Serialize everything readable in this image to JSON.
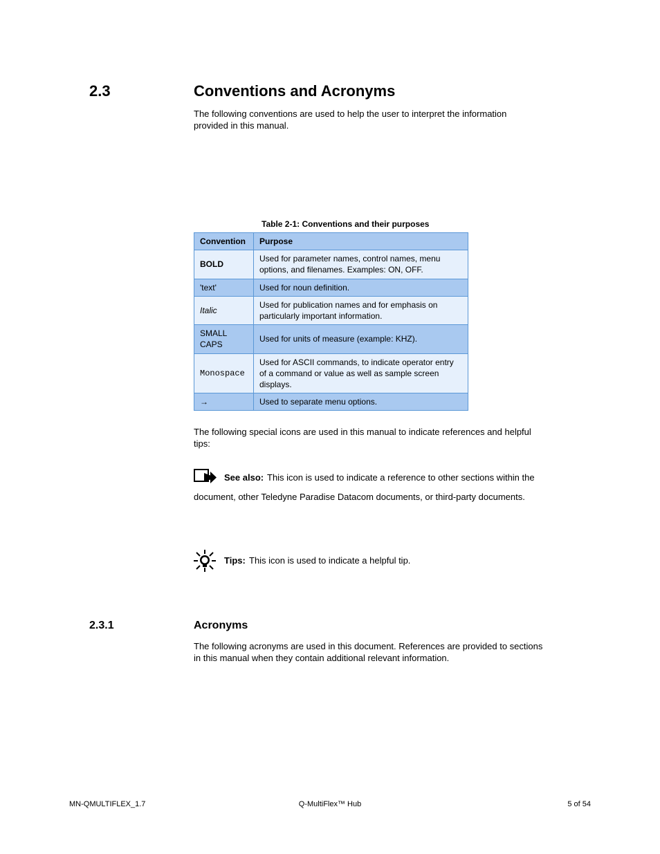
{
  "section": {
    "number": "2.3",
    "title": "Conventions and Acronyms"
  },
  "intro1": "The following conventions are used to help the user to interpret the information",
  "intro2": "provided in this manual.",
  "table": {
    "caption": "Table 2-1: Conventions and their purposes",
    "head": {
      "conv": "Convention",
      "purpose": "Purpose"
    },
    "rows": [
      {
        "conv": "BOLD",
        "purpose": "Used for parameter names, control names, menu options, and filenames. Examples: ON, OFF."
      },
      {
        "conv": "'text'",
        "purpose": "Used for noun definition."
      },
      {
        "conv": "Italic",
        "purpose": "Used for publication names and for emphasis on particularly important information."
      },
      {
        "conv": "SMALL CAPS",
        "purpose": "Used for units of measure (example: KHZ)."
      },
      {
        "conv": "Monospace",
        "purpose": "Used for ASCII commands, to indicate operator entry of a command or value as well as sample screen displays."
      },
      {
        "conv": "→",
        "purpose": "Used to separate menu options."
      }
    ]
  },
  "icons_intro1": "The following special icons are used in this manual to indicate references and helpful",
  "icons_intro2": "tips:",
  "see_also": "See also:",
  "see_also_desc1": "This icon is used to indicate a reference to other sections within the",
  "see_also_desc2": "document, other Teledyne Paradise Datacom documents, or third-party documents.",
  "tips": "Tips:",
  "tips_desc": "This icon is used to indicate a helpful tip.",
  "acronyms": {
    "number": "2.3.1",
    "title": "Acronyms",
    "line1": "The following acronyms are used in this document. References are provided to sections",
    "line2": "in this manual when they contain additional relevant information."
  },
  "footer": {
    "pub": "MN-QMULTIFLEX_1.7",
    "title": "Q-MultiFlex™ Hub",
    "page": "5 of 54"
  }
}
